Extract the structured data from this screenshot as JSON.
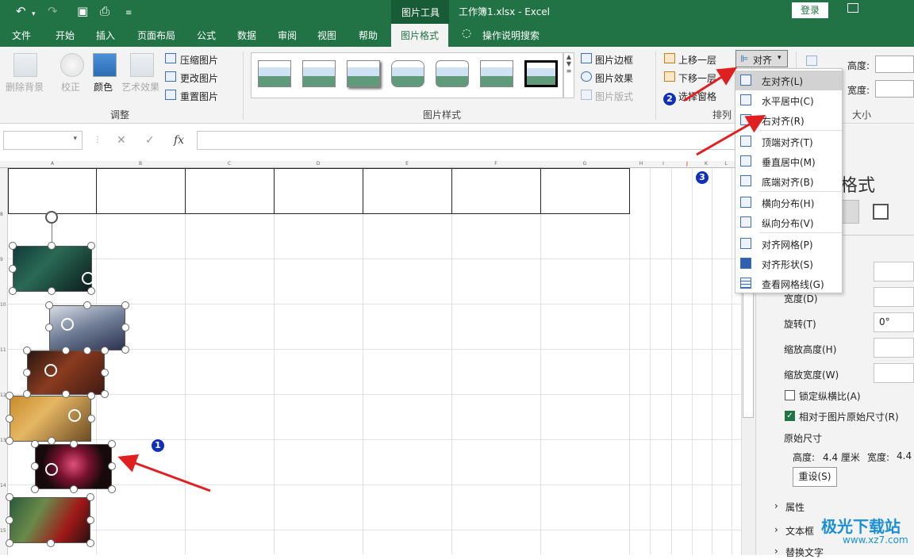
{
  "titlebar": {
    "context_tool": "图片工具",
    "file_title": "工作簿1.xlsx",
    "app_name": "Excel",
    "login": "登录"
  },
  "tabs": [
    "文件",
    "开始",
    "插入",
    "页面布局",
    "公式",
    "数据",
    "审阅",
    "视图",
    "帮助",
    "图片格式",
    "操作说明搜索"
  ],
  "ribbon": {
    "adjust": {
      "remove_bg": "删除背景",
      "corrections": "校正",
      "color": "颜色",
      "artistic": "艺术效果",
      "compress": "压缩图片",
      "change": "更改图片",
      "reset": "重置图片",
      "group": "调整"
    },
    "styles": {
      "border": "图片边框",
      "effects": "图片效果",
      "layout": "图片版式",
      "group": "图片样式"
    },
    "arrange": {
      "forward": "上移一层",
      "backward": "下移一层",
      "selection_pane": "选择窗格",
      "align": "对齐",
      "group": "排列"
    },
    "size": {
      "height": "高度:",
      "width": "宽度:",
      "group": "大小"
    }
  },
  "align_menu": [
    "左对齐(L)",
    "水平居中(C)",
    "右对齐(R)",
    "顶端对齐(T)",
    "垂直居中(M)",
    "底端对齐(B)",
    "横向分布(H)",
    "纵向分布(V)",
    "对齐网格(P)",
    "对齐形状(S)",
    "查看网格线(G)"
  ],
  "formula_bar": {
    "fx": "fx",
    "cancel": "✕",
    "enter": "✓"
  },
  "columns": [
    "A",
    "B",
    "C",
    "D",
    "E",
    "F",
    "G",
    "H",
    "I",
    "J",
    "K",
    "L"
  ],
  "rows": [
    "8",
    "9",
    "10",
    "11",
    "12",
    "13",
    "14",
    "15"
  ],
  "format_pane": {
    "title": "格式",
    "width_label": "宽度(D)",
    "rotation_label": "旋转(T)",
    "rotation_value": "0°",
    "scale_height": "缩放高度(H)",
    "scale_width": "缩放宽度(W)",
    "lock_aspect": "锁定纵横比(A)",
    "relative_original": "相对于图片原始尺寸(R)",
    "original_size": "原始尺寸",
    "orig_height_label": "高度:",
    "orig_height_value": "4.4 厘米",
    "orig_width_label": "宽度:",
    "orig_width_value": "4.4",
    "reset": "重设(S)",
    "properties": "属性",
    "textbox": "文本框",
    "alt_text": "替换文字"
  },
  "badges": [
    "1",
    "2",
    "3"
  ],
  "watermark": {
    "name": "极光下载站",
    "url": "www.xz7.com"
  },
  "colors": {
    "excel_green": "#217346",
    "arrow_red": "#e02020",
    "badge_blue": "#1330b8"
  }
}
